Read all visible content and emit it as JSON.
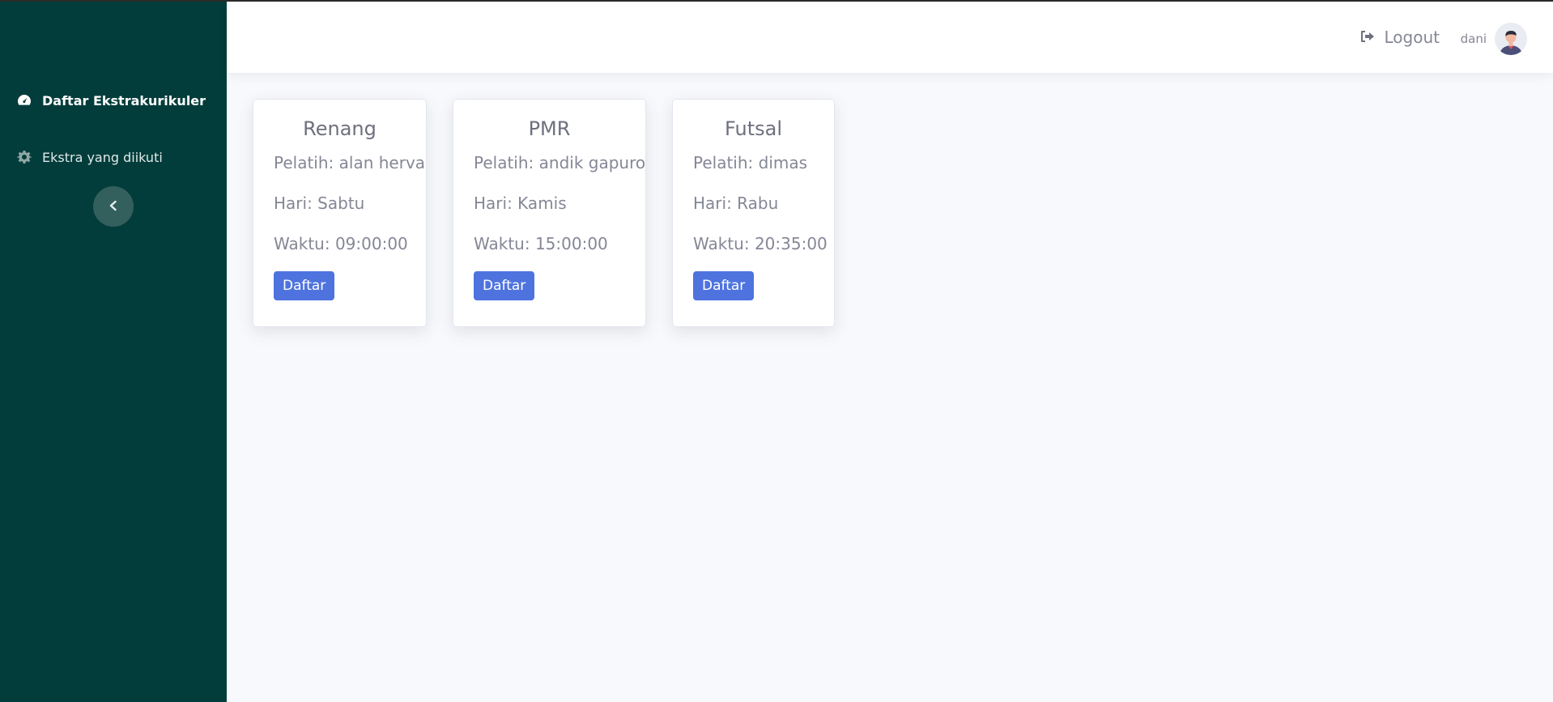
{
  "sidebar": {
    "items": [
      {
        "label": "Daftar Ekstrakurikuler",
        "icon": "tachometer-icon",
        "active": true
      },
      {
        "label": "Ekstra yang diikuti",
        "icon": "gear-icon",
        "active": false
      }
    ],
    "toggle_icon": "chevron-left-icon"
  },
  "topbar": {
    "logout_label": "Logout",
    "logout_icon": "sign-out-icon",
    "username": "dani",
    "avatar_icon": "user-avatar-icon"
  },
  "cards": [
    {
      "title": "Renang",
      "pelatih": "Pelatih: alan herva",
      "hari": "Hari: Sabtu",
      "waktu": "Waktu: 09:00:00",
      "button": "Daftar"
    },
    {
      "title": "PMR",
      "pelatih": "Pelatih: andik gapuro",
      "hari": "Hari: Kamis",
      "waktu": "Waktu: 15:00:00",
      "button": "Daftar"
    },
    {
      "title": "Futsal",
      "pelatih": "Pelatih: dimas",
      "hari": "Hari: Rabu",
      "waktu": "Waktu: 20:35:00",
      "button": "Daftar"
    }
  ],
  "colors": {
    "sidebar_bg": "#023d3b",
    "accent_button": "#4e73df",
    "page_bg": "#f8f9fc"
  }
}
